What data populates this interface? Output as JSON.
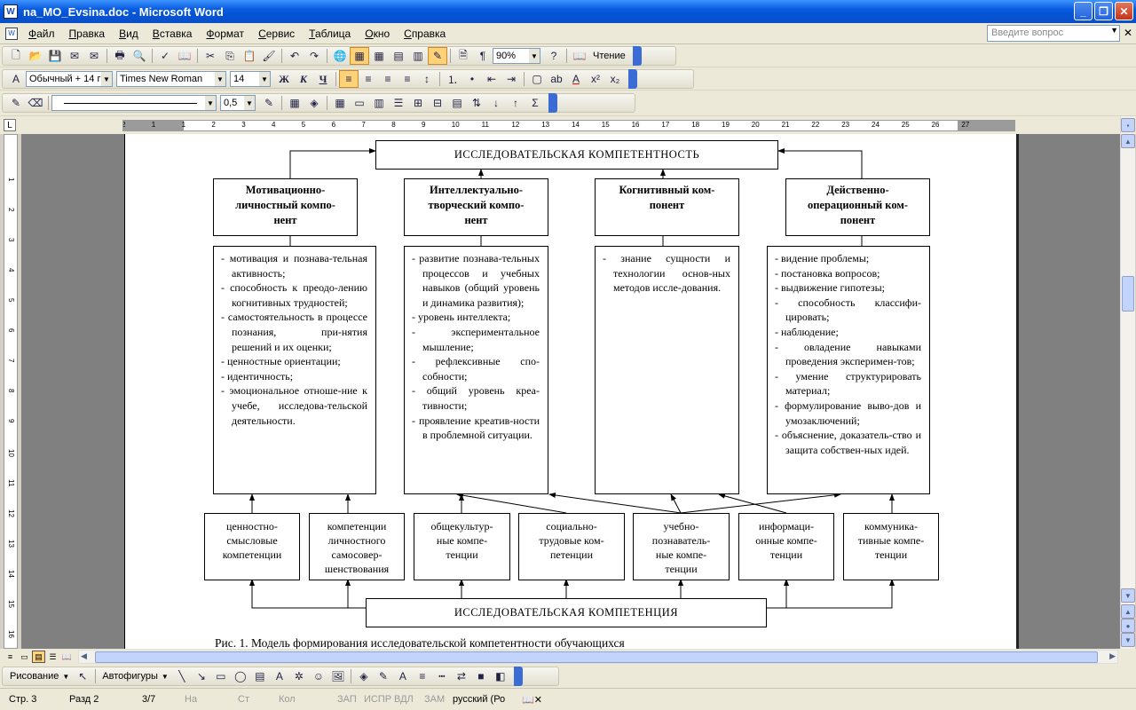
{
  "window": {
    "title": "na_MO_Evsina.doc - Microsoft Word",
    "icon": "word-doc-icon"
  },
  "menu": [
    "Файл",
    "Правка",
    "Вид",
    "Вставка",
    "Формат",
    "Сервис",
    "Таблица",
    "Окно",
    "Справка"
  ],
  "ask": {
    "placeholder": "Введите вопрос"
  },
  "standard_toolbar": {
    "zoom": "90%",
    "reading": "Чтение"
  },
  "formatting_toolbar": {
    "style": "Обычный + 14 г",
    "font": "Times New Roman",
    "size": "14",
    "bold": "Ж",
    "italic": "К",
    "underline": "Ч"
  },
  "tables_toolbar": {
    "line_weight": "0,5"
  },
  "ruler": {
    "marks": [
      "2",
      "1",
      "1",
      "2",
      "3",
      "4",
      "5",
      "6",
      "7",
      "8",
      "9",
      "10",
      "11",
      "12",
      "13",
      "14",
      "15",
      "16",
      "17",
      "18",
      "19",
      "20",
      "21",
      "22",
      "23",
      "24",
      "25",
      "26",
      "27"
    ]
  },
  "vruler": {
    "marks": [
      "1",
      "2",
      "3",
      "4",
      "5",
      "6",
      "7",
      "8",
      "9",
      "10",
      "11",
      "12",
      "13",
      "14",
      "15",
      "16"
    ]
  },
  "diagram": {
    "top": "ИССЛЕДОВАТЕЛЬСКАЯ КОМПЕТЕНТНОСТЬ",
    "bottom": "ИССЛЕДОВАТЕЛЬСКАЯ КОМПЕТЕНЦИЯ",
    "components": [
      {
        "head": [
          "Мотивационно-",
          "личностный компо-",
          "нент"
        ],
        "items": [
          "- мотивация и познава-тельная активность;",
          "- способность к преодо-лению когнитивных трудностей;",
          "- самостоятельность в процессе познания, при-нятия решений и их оценки;",
          "- ценностные ориентации;",
          "- идентичность;",
          "- эмоциональное отноше-ние к учебе, исследова-тельской деятельности."
        ]
      },
      {
        "head": [
          "Интеллектуально-",
          "творческий компо-",
          "нент"
        ],
        "items": [
          "- развитие познава-тельных процессов и учебных навыков (общий уровень и динамика развития);",
          "- уровень интеллекта;",
          "- экспериментальное мышление;",
          "- рефлексивные спо-собности;",
          "- общий уровень креа-тивности;",
          "- проявление креатив-ности в проблемной ситуации."
        ]
      },
      {
        "head": [
          "Когнитивный ком-",
          "понент"
        ],
        "items": [
          "- знание сущности и технологии основ-ных методов иссле-дования."
        ]
      },
      {
        "head": [
          "Действенно-",
          "операционный ком-",
          "понент"
        ],
        "items": [
          "- видение проблемы;",
          "- постановка вопросов;",
          "- выдвижение гипотезы;",
          "- способность классифи-цировать;",
          "- наблюдение;",
          "- овладение навыками проведения эксперимен-тов;",
          "- умение структурировать материал;",
          "- формулирование выво-дов и умозаключений;",
          "- объяснение, доказатель-ство и защита собствен-ных идей."
        ]
      }
    ],
    "competences": [
      [
        "ценностно-",
        "смысловые",
        "компетенции"
      ],
      [
        "компетенции",
        "личностного",
        "самосовер-",
        "шенствования"
      ],
      [
        "общекультур-",
        "ные компе-",
        "тенции"
      ],
      [
        "социально-",
        "трудовые ком-",
        "петенции"
      ],
      [
        "учебно-",
        "познаватель-",
        "ные компе-",
        "тенции"
      ],
      [
        "информаци-",
        "онные компе-",
        "тенции"
      ],
      [
        "коммуника-",
        "тивные компе-",
        "тенции"
      ]
    ],
    "caption": "Рис. 1. Модель формирования исследовательской компетентности обучающихся"
  },
  "drawing_toolbar": {
    "drawing": "Рисование",
    "autoshapes": "Автофигуры"
  },
  "status": {
    "page": "Стр. 3",
    "section": "Разд 2",
    "pages": "3/7",
    "at": "На",
    "line": "Ст",
    "col": "Кол",
    "rec": "ЗАП",
    "trk": "ИСПР",
    "ext": "ВДЛ",
    "ovr": "ЗАМ",
    "lang": "русский (Ро"
  }
}
